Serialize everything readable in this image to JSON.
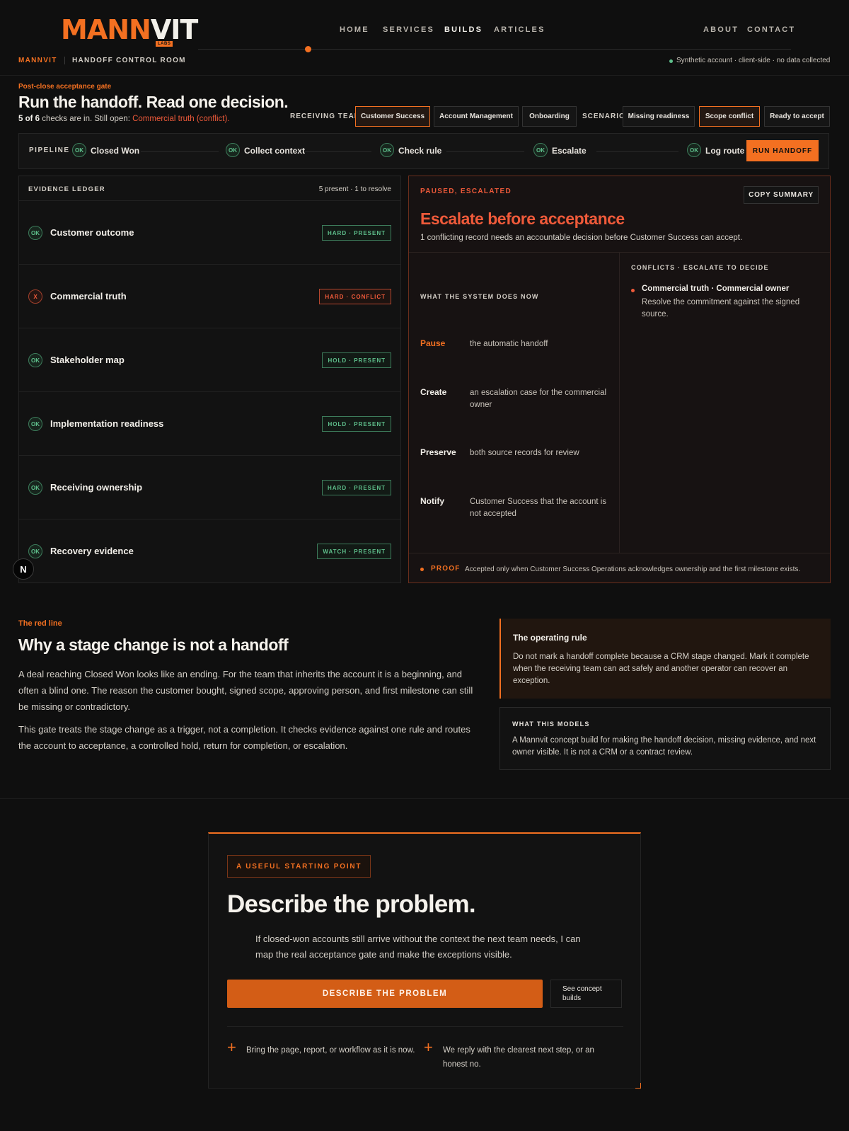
{
  "header": {
    "logo": {
      "left": "MANN",
      "right": "VIT",
      "sub": "LABS"
    },
    "nav": [
      "HOME",
      "SERVICES",
      "BUILDS",
      "ARTICLES",
      "ABOUT",
      "CONTACT"
    ]
  },
  "subbar": {
    "brand": "MANNVIT",
    "section": "HANDOFF CONTROL ROOM",
    "notice": "Synthetic account · client-side · no data collected"
  },
  "hero": {
    "eyebrow": "Post-close acceptance gate",
    "title": "Run the handoff. Read one decision.",
    "status_count": "5 of 6",
    "status_mid": " checks are in. Still open: ",
    "status_open": "Commercial truth (conflict)."
  },
  "controls": {
    "team_label": "RECEIVING TEAM",
    "teams": [
      "Customer Success",
      "Account Management",
      "Onboarding"
    ],
    "scenario_label": "SCENARIO",
    "scenarios": [
      "Missing readiness",
      "Scope conflict",
      "Ready to accept"
    ]
  },
  "pipeline": {
    "label": "PIPELINE",
    "ok": "OK",
    "steps": [
      "Closed Won",
      "Collect context",
      "Check rule",
      "Escalate",
      "Log route"
    ],
    "run": "RUN HANDOFF"
  },
  "ledger": {
    "title": "EVIDENCE LEDGER",
    "summary": "5 present · 1 to resolve",
    "rows": [
      {
        "status": "OK",
        "name": "Customer outcome",
        "badge": "HARD · PRESENT"
      },
      {
        "status": "X",
        "name": "Commercial truth",
        "badge": "HARD · CONFLICT"
      },
      {
        "status": "OK",
        "name": "Stakeholder map",
        "badge": "HOLD · PRESENT"
      },
      {
        "status": "OK",
        "name": "Implementation readiness",
        "badge": "HOLD · PRESENT"
      },
      {
        "status": "OK",
        "name": "Receiving ownership",
        "badge": "HARD · PRESENT"
      },
      {
        "status": "OK",
        "name": "Recovery evidence",
        "badge": "WATCH · PRESENT"
      }
    ]
  },
  "decision": {
    "state": "PAUSED, ESCALATED",
    "copy": "COPY SUMMARY",
    "title": "Escalate before acceptance",
    "desc": "1 conflicting record needs an accountable decision before Customer Success can accept.",
    "actions_title": "WHAT THE SYSTEM DOES NOW",
    "actions": [
      {
        "k": "Pause",
        "v": "the automatic handoff"
      },
      {
        "k": "Create",
        "v": "an escalation case for the commercial owner"
      },
      {
        "k": "Preserve",
        "v": "both source records for review"
      },
      {
        "k": "Notify",
        "v": "Customer Success that the account is not accepted"
      }
    ],
    "conflicts_title": "CONFLICTS · ESCALATE TO DECIDE",
    "conflict_head": "Commercial truth · Commercial owner",
    "conflict_body": "Resolve the commitment against the signed source.",
    "proof_label": "PROOF",
    "proof_text": "Accepted only when Customer Success Operations acknowledges ownership and the first milestone exists."
  },
  "redline": {
    "eyebrow": "The red line",
    "title": "Why a stage change is not a handoff",
    "p1": "A deal reaching Closed Won looks like an ending. For the team that inherits the account it is a beginning, and often a blind one. The reason the customer bought, signed scope, approving person, and first milestone can still be missing or contradictory.",
    "p2": "This gate treats the stage change as a trigger, not a completion. It checks evidence against one rule and routes the account to acceptance, a controlled hold, return for completion, or escalation.",
    "rule_title": "The operating rule",
    "rule_body": "Do not mark a handoff complete because a CRM stage changed. Mark it complete when the receiving team can act safely and another operator can recover an exception.",
    "models_title": "WHAT THIS MODELS",
    "models_body": "A Mannvit concept build for making the handoff decision, missing evidence, and next owner visible. It is not a CRM or a contract review."
  },
  "cta": {
    "tag": "A USEFUL STARTING POINT",
    "title": "Describe the problem.",
    "body": "If closed-won accounts still arrive without the context the next team needs, I can map the real acceptance gate and make the exceptions visible.",
    "primary": "DESCRIBE THE PROBLEM",
    "secondary": "See concept builds",
    "note1": "Bring the page, report, or workflow as it is now.",
    "note2": "We reply with the clearest next step, or an honest no."
  },
  "badge_n": "N"
}
